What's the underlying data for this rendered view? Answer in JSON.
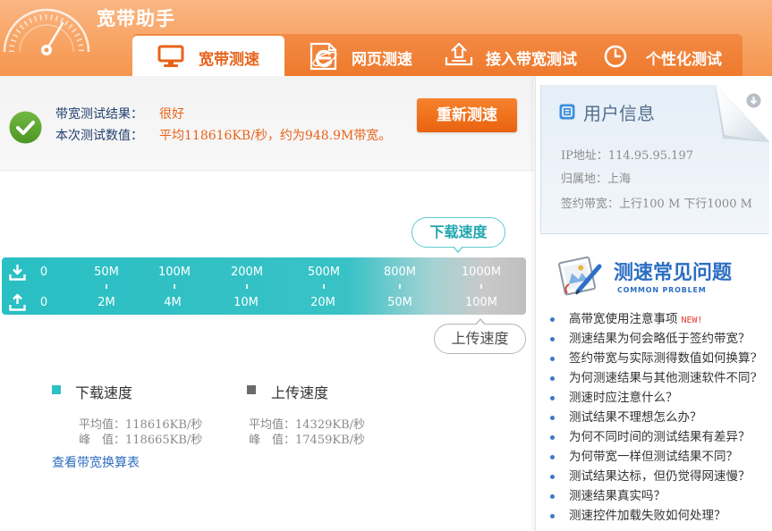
{
  "app": {
    "title": "宽带助手",
    "logo_icon": "speedometer-icon"
  },
  "tabs": [
    {
      "label": "宽带测速",
      "icon": "monitor-icon",
      "active": true
    },
    {
      "label": "网页测速",
      "icon": "ie-browser-icon",
      "active": false
    },
    {
      "label": "接入带宽测试",
      "icon": "upload-tray-icon",
      "active": false
    },
    {
      "label": "个性化测试",
      "icon": "clock-icon",
      "active": false
    }
  ],
  "result": {
    "icon": "check-circle-icon",
    "status_label": "带宽测试结果：",
    "status_value": "很好",
    "measure_label": "本次测试数值：",
    "measure_value": "平均118616KB/秒，约为948.9M带宽。",
    "retest_button": "重新测速"
  },
  "speed_bar": {
    "download_icon": "download-icon",
    "upload_icon": "upload-icon",
    "download_scale": [
      "0",
      "50M",
      "100M",
      "200M",
      "500M",
      "800M",
      "1000M"
    ],
    "upload_scale": [
      "0",
      "2M",
      "4M",
      "10M",
      "20M",
      "50M",
      "100M"
    ],
    "download_tag": "下载速度",
    "upload_tag": "上传速度"
  },
  "legend": {
    "download": {
      "label": "下载速度",
      "average": "平均值：118616KB/秒",
      "peak": "峰　值：118665KB/秒",
      "color": "#2cc1c4"
    },
    "upload": {
      "label": "上传速度",
      "average": "平均值：14329KB/秒",
      "peak": "峰　值：17459KB/秒",
      "color": "#6a6a6a"
    }
  },
  "conversion_link": "查看带宽换算表",
  "user_info": {
    "icon": "user-info-icon",
    "title": "用户信息",
    "ip": "IP地址：114.95.95.197",
    "location": "归属地：上海",
    "bandwidth": "签约带宽：上行100 M 下行1000 M",
    "collapse_icon": "arrow-down-circle-icon"
  },
  "faq": {
    "icon": "clipboard-pencil-icon",
    "title": "测速常见问题",
    "subtitle": "COMMON PROBLEM",
    "items": [
      {
        "text": "高带宽使用注意事项",
        "badge": "NEW!"
      },
      {
        "text": "测速结果为何会略低于签约带宽？"
      },
      {
        "text": "签约带宽与实际测得数值如何换算?"
      },
      {
        "text": "为何测速结果与其他测速软件不同?"
      },
      {
        "text": "测速时应注意什么？"
      },
      {
        "text": "测试结果不理想怎么办？"
      },
      {
        "text": "为何不同时间的测试结果有差异？"
      },
      {
        "text": "为何带宽一样但测试结果不同？"
      },
      {
        "text": "测试结果达标，但仍觉得网速慢？"
      },
      {
        "text": "测速结果真实吗？"
      },
      {
        "text": "测速控件加载失败如何处理？"
      }
    ]
  },
  "colors": {
    "header_orange": "#f8a464",
    "accent_orange": "#e8631a",
    "teal": "#2cc1c4",
    "link_blue": "#2e6cbf",
    "success_green": "#5aa62c"
  }
}
